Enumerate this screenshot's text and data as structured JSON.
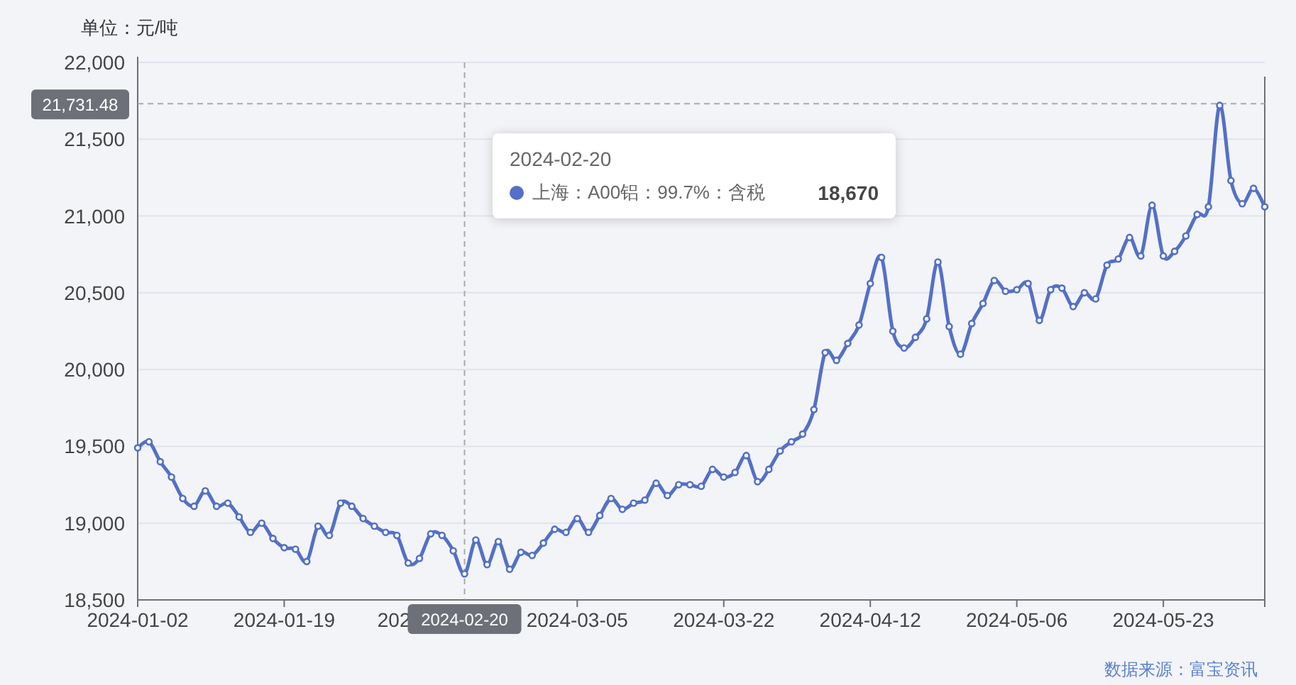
{
  "unit_label": "单位：元/吨",
  "chart": {
    "chart_data": {
      "type": "line",
      "categories": [
        "2024-01-02",
        null,
        null,
        null,
        null,
        null,
        null,
        null,
        null,
        null,
        null,
        null,
        null,
        "2024-01-19",
        null,
        null,
        null,
        null,
        null,
        null,
        null,
        null,
        null,
        null,
        null,
        null,
        null,
        null,
        null,
        "2024-02-20",
        null,
        null,
        null,
        null,
        null,
        null,
        null,
        null,
        null,
        "2024-03-05",
        null,
        null,
        null,
        null,
        null,
        null,
        null,
        null,
        null,
        null,
        null,
        null,
        "2024-03-22",
        null,
        null,
        null,
        null,
        null,
        null,
        null,
        null,
        null,
        null,
        null,
        null,
        "2024-04-12",
        null,
        null,
        null,
        null,
        null,
        null,
        null,
        null,
        null,
        null,
        null,
        null,
        "2024-05-06",
        null,
        null,
        null,
        null,
        null,
        null,
        null,
        null,
        null,
        null,
        null,
        null,
        "2024-05-23",
        null,
        null,
        null,
        null,
        null,
        null,
        null,
        null,
        null
      ],
      "series": [
        {
          "name": "上海：A00铝：99.7%：含税",
          "color": "#5470c6",
          "marker": "circle",
          "values": [
            19490,
            19530,
            19400,
            19300,
            19160,
            19110,
            19210,
            19110,
            19130,
            19040,
            18940,
            19000,
            18900,
            18840,
            18830,
            18750,
            18980,
            18920,
            19130,
            19110,
            19030,
            18980,
            18940,
            18920,
            18740,
            18770,
            18930,
            18920,
            18820,
            18670,
            18890,
            18730,
            18880,
            18700,
            18810,
            18790,
            18870,
            18960,
            18940,
            19030,
            18940,
            19050,
            19160,
            19090,
            19130,
            19150,
            19260,
            19180,
            19250,
            19250,
            19240,
            19350,
            19300,
            19330,
            19440,
            19270,
            19350,
            19470,
            19530,
            19580,
            19740,
            20110,
            20060,
            20170,
            20290,
            20560,
            20730,
            20250,
            20140,
            20210,
            20330,
            20700,
            20280,
            20100,
            20300,
            20430,
            20580,
            20510,
            20520,
            20560,
            20320,
            20520,
            20530,
            20410,
            20500,
            20460,
            20680,
            20720,
            20860,
            20740,
            21070,
            20740,
            20770,
            20870,
            21010,
            21060,
            21720,
            21230,
            21080,
            21180,
            21060
          ]
        }
      ],
      "ylim": [
        18500,
        22000
      ],
      "grid": true,
      "yticks": [
        {
          "value": 18500,
          "label": "18,500"
        },
        {
          "value": 19000,
          "label": "19,000"
        },
        {
          "value": 19500,
          "label": "19,500"
        },
        {
          "value": 20000,
          "label": "20,000"
        },
        {
          "value": 20500,
          "label": "20,500"
        },
        {
          "value": 21000,
          "label": "21,000"
        },
        {
          "value": 21500,
          "label": "21,500"
        },
        {
          "value": 22000,
          "label": "22,000"
        }
      ],
      "ref_lines": [
        {
          "axis": "x",
          "value": "2024-02-20"
        },
        {
          "axis": "y",
          "value": 21731.48,
          "label": "21,731.48"
        }
      ]
    },
    "covered_axis_label": "202",
    "tooltip": {
      "title": "2024-02-20",
      "value": "18,670"
    }
  },
  "source": "数据来源：富宝资讯"
}
